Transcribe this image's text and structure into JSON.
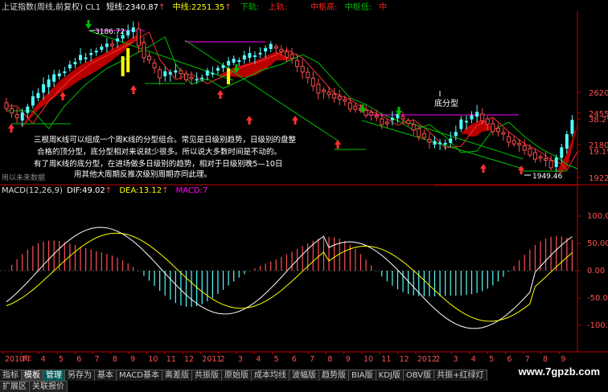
{
  "header": {
    "title": "上证指数(周线,前复权) CL1",
    "short_label": "短线:",
    "short_value": "2340.87",
    "short_arrow": "↑",
    "mid_label": "中线:",
    "mid_value": "2251.35",
    "mid_arrow": "↑",
    "down_label": "下轨:",
    "up_label": "上轨:",
    "mid_high_label": "中枢高:",
    "mid_low_label": "中枢低:",
    "mid_label2": "中"
  },
  "price_labels": {
    "high": "3186.72",
    "low": "1949.46",
    "bottom_pattern": "底分型",
    "future": "用以未来数据"
  },
  "price_axis": [
    "2620",
    "2455",
    "38.2%",
    "2180",
    "19.1%",
    "1922"
  ],
  "annotation": {
    "line1": "三根周K线可以组成一个周K线的分型组合。常见是日级别趋势，日级别的盘整",
    "line2": "合格的顶分型，底分型相对来说就少很多。所以说大多数时间是不动的。",
    "line3": "有了周K线的底分型，在进场做多日级别的趋势，相对于日级别晚5—10日",
    "line4": "用其他大周期反推次级别周期亦同此理。"
  },
  "macd": {
    "title": "MACD(12,26,9)",
    "dif_label": "DIF:",
    "dif_value": "49.02",
    "dif_arrow": "↑",
    "dea_label": "DEA:",
    "dea_value": "13.12",
    "dea_arrow": "↑",
    "macd_label": "MACD:",
    "macd_value": "7",
    "axis": [
      "100.00",
      "50.00",
      "0.00",
      "-50.00",
      "-100.00"
    ]
  },
  "time_axis": [
    "2010年",
    "F",
    "4",
    "5",
    "6",
    "7",
    "8",
    "9",
    "10",
    "11",
    "12",
    "2011",
    "2",
    "3",
    "4",
    "5",
    "6",
    "7",
    "8",
    "9",
    "10",
    "11",
    "12",
    "2012",
    "2",
    "3",
    "4",
    "5",
    "6",
    "7",
    "8",
    "9"
  ],
  "tabs": [
    "指标",
    "模板",
    "管理",
    "另存为",
    "基本",
    "MACD基本",
    "离差版",
    "共振版",
    "原始版",
    "成本均线",
    "波幅版",
    "趋势版",
    "BIA版",
    "KDJ版",
    "OBV版",
    "共振+红绿灯"
  ],
  "bottom_tabs": [
    "扩展区",
    "关联报价"
  ],
  "watermark": "www.7gpzb.com",
  "colors": {
    "up": "#ff5050",
    "down": "#54fcfc",
    "yellow": "#ffff00",
    "white": "#ffffff",
    "green": "#00c000",
    "magenta": "#ff00ff",
    "red_fill": "#cc0000",
    "axis_red": "#c00000"
  }
}
